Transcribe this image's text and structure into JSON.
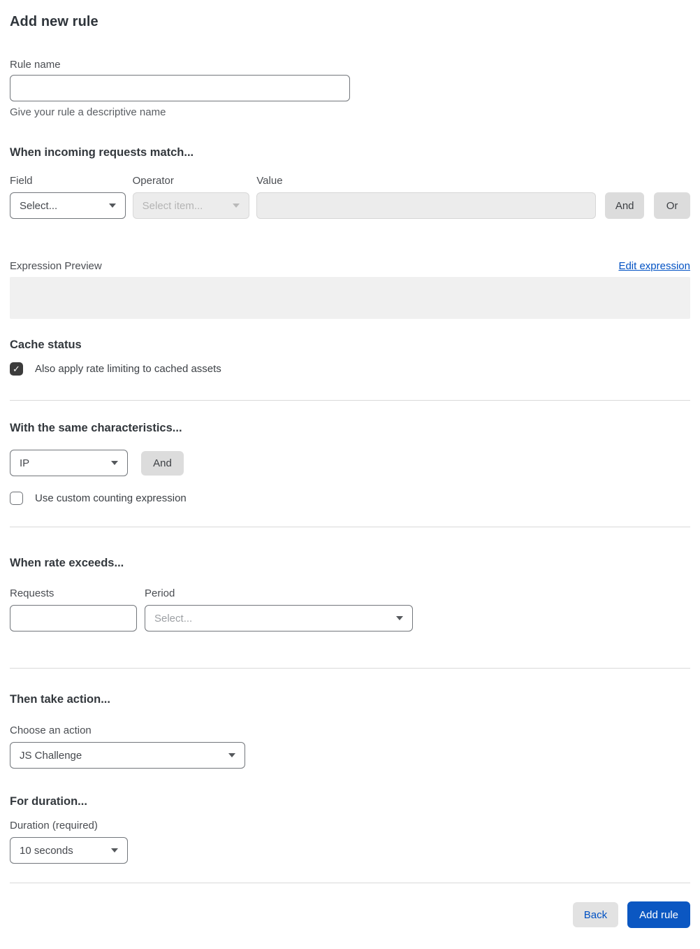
{
  "page": {
    "title": "Add new rule"
  },
  "rule_name": {
    "label": "Rule name",
    "value": "",
    "helper": "Give your rule a descriptive name"
  },
  "match": {
    "heading": "When incoming requests match...",
    "field": {
      "label": "Field",
      "selected": "Select..."
    },
    "operator": {
      "label": "Operator",
      "selected": "Select item..."
    },
    "value": {
      "label": "Value",
      "value": ""
    },
    "and_label": "And",
    "or_label": "Or"
  },
  "expression": {
    "preview_label": "Expression Preview",
    "edit_link": "Edit expression",
    "value": ""
  },
  "cache_status": {
    "heading": "Cache status",
    "checkbox_label": "Also apply rate limiting to cached assets",
    "checked": true,
    "check_glyph": "✓"
  },
  "characteristics": {
    "heading": "With the same characteristics...",
    "selected": "IP",
    "and_label": "And",
    "custom_counting_label": "Use custom counting expression",
    "custom_counting_checked": false
  },
  "rate": {
    "heading": "When rate exceeds...",
    "requests": {
      "label": "Requests",
      "value": ""
    },
    "period": {
      "label": "Period",
      "selected": "Select..."
    }
  },
  "action": {
    "heading": "Then take action...",
    "choose_label": "Choose an action",
    "selected": "JS Challenge"
  },
  "duration": {
    "heading": "For duration...",
    "label": "Duration (required)",
    "selected": "10 seconds"
  },
  "footer": {
    "back_label": "Back",
    "add_rule_label": "Add rule"
  },
  "colors": {
    "accent_blue": "#0b57c2",
    "link_blue": "#0051c3",
    "disabled_bg": "#ececec",
    "gray_button_bg": "#dcdcdc",
    "checkbox_checked_bg": "#3c3c3c",
    "divider": "#d9d9d9",
    "preview_box_bg": "#f0f0f0"
  }
}
